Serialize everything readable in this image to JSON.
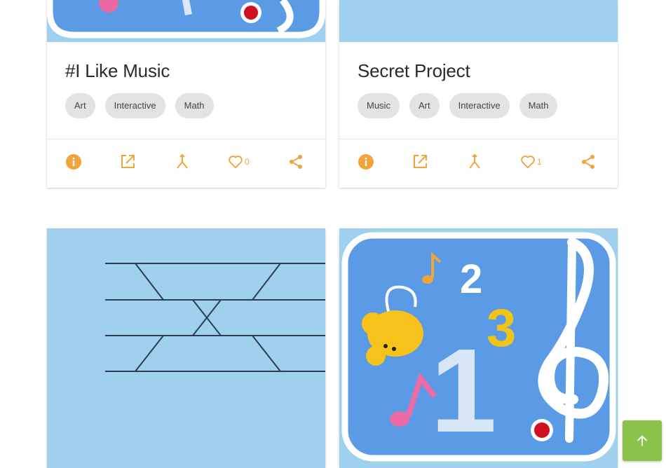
{
  "cards": [
    {
      "title": "#I Like Music",
      "tags": [
        "Art",
        "Interactive",
        "Math"
      ],
      "likes": "0"
    },
    {
      "title": "Secret Project",
      "tags": [
        "Music",
        "Art",
        "Interactive",
        "Math"
      ],
      "likes": "1"
    }
  ],
  "thumbnail_text": {
    "one": "1",
    "two": "2",
    "three": "3"
  },
  "colors": {
    "accent": "#f0a43a",
    "thumb_bg": "#9fd0ee",
    "tag_bg": "#e3e3e3",
    "scroll_button": "#8bc34a"
  },
  "icons": {
    "info": "info-icon",
    "open": "open-external-icon",
    "remix": "remix-icon",
    "like": "heart-icon",
    "share": "share-icon",
    "scroll": "arrow-up-icon"
  }
}
